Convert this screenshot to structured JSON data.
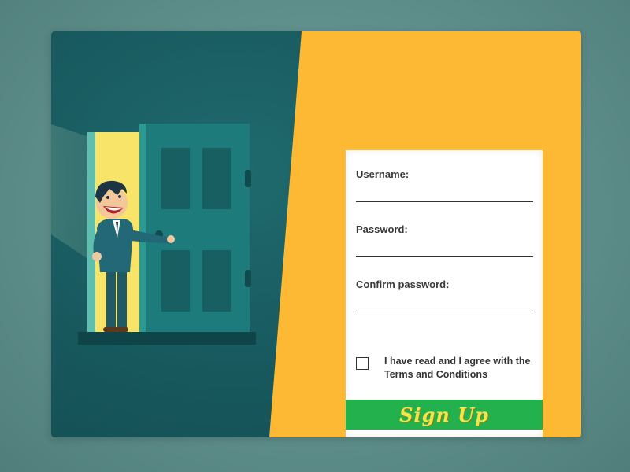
{
  "form": {
    "username_label": "Username:",
    "username_value": "",
    "password_label": "Password:",
    "password_value": "",
    "confirm_label": "Confirm password:",
    "confirm_value": "",
    "terms_text": "I have read and I agree with the Terms and Conditions",
    "terms_checked": false,
    "signup_label": "Sign Up"
  },
  "colors": {
    "background": "#6f9e99",
    "dark_panel": "#17585d",
    "accent_panel": "#fdb933",
    "signup_button": "#22b14c",
    "signup_text": "#f2e54a"
  }
}
